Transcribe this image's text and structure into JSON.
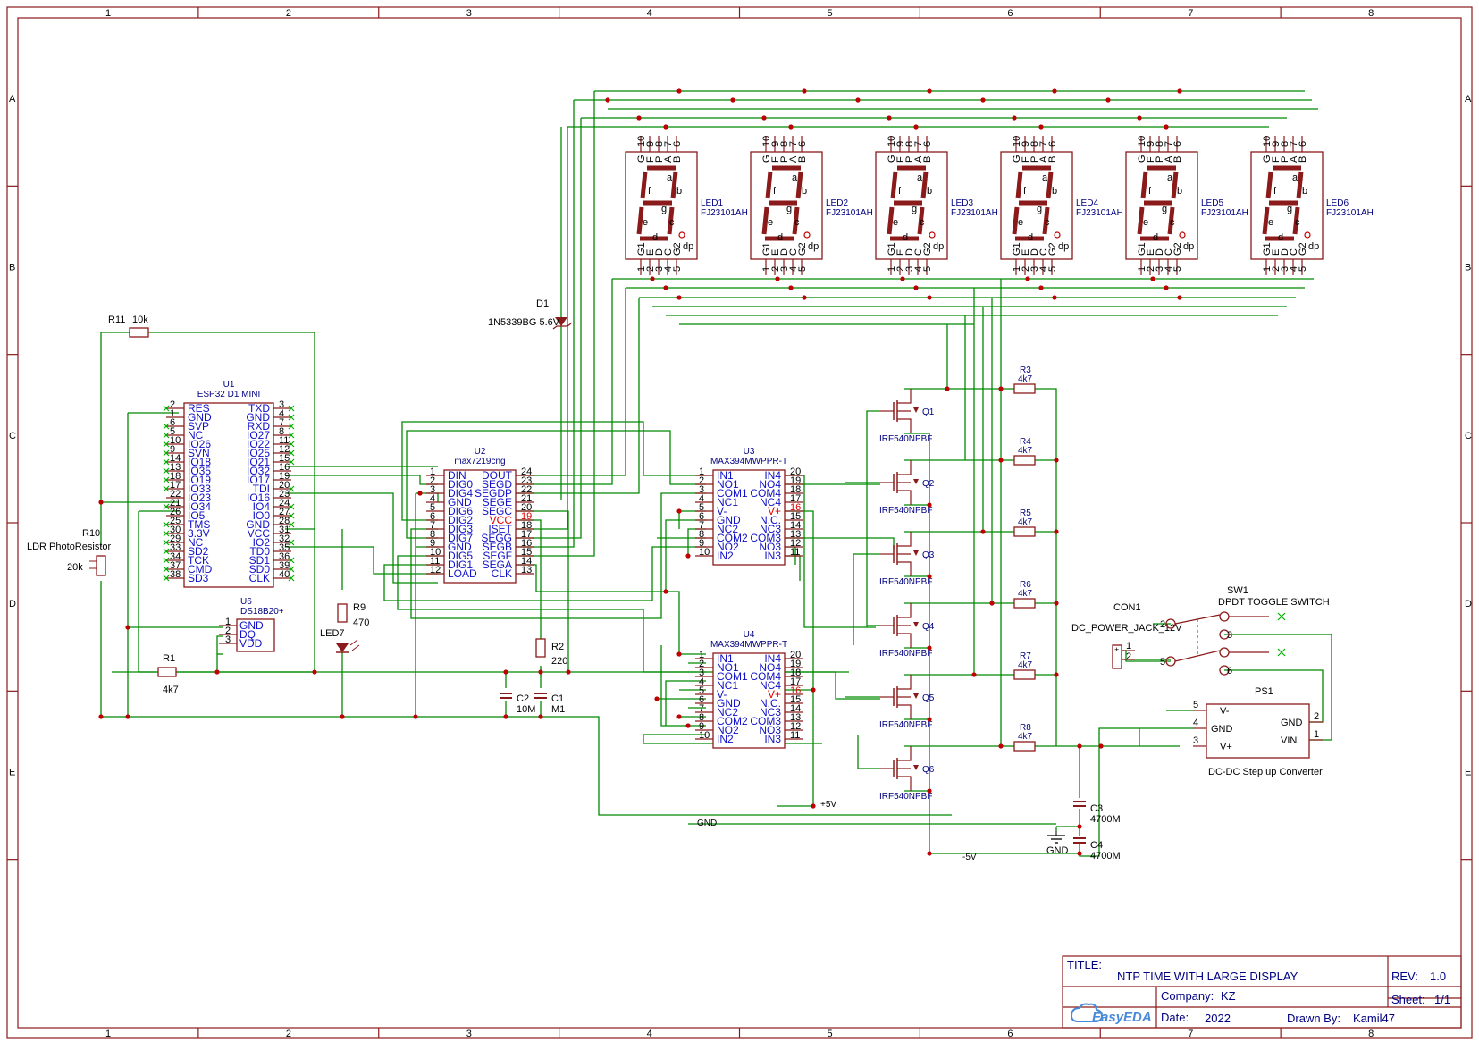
{
  "frame": {
    "col_labels": [
      "1",
      "2",
      "3",
      "4",
      "5",
      "6",
      "7",
      "8"
    ],
    "row_labels": [
      "A",
      "B",
      "C",
      "D",
      "E"
    ]
  },
  "displays": [
    {
      "ref": "LED1",
      "part": "FJ23101AH"
    },
    {
      "ref": "LED2",
      "part": "FJ23101AH"
    },
    {
      "ref": "LED3",
      "part": "FJ23101AH"
    },
    {
      "ref": "LED4",
      "part": "FJ23101AH"
    },
    {
      "ref": "LED5",
      "part": "FJ23101AH"
    },
    {
      "ref": "LED6",
      "part": "FJ23101AH"
    }
  ],
  "display_pins": {
    "top_nums": [
      "10",
      "9",
      "8",
      "7",
      "6"
    ],
    "top_names": [
      "G",
      "F",
      "P",
      "A",
      "B"
    ],
    "bottom_nums": [
      "1",
      "2",
      "3",
      "4",
      "5"
    ],
    "bottom_names": [
      "G1",
      "E",
      "D",
      "C",
      "G2"
    ],
    "seg_labels": [
      "a",
      "b",
      "f",
      "g",
      "e",
      "c",
      "d",
      "dp"
    ]
  },
  "u1": {
    "ref": "U1",
    "name": "ESP32 D1 MINI",
    "left_nums": [
      "2",
      "1",
      "6",
      "5",
      "10",
      "9",
      "14",
      "13",
      "18",
      "17",
      "22",
      "21",
      "26",
      "25",
      "30",
      "29",
      "33",
      "34",
      "37",
      "38"
    ],
    "left_names": [
      "RES",
      "GND",
      "SVP",
      "NC",
      "IO26",
      "SVN",
      "IO18",
      "IO35",
      "IO19",
      "IO33",
      "IO23",
      "IO34",
      "IO5",
      "TMS",
      "3.3V",
      "NC",
      "SD2",
      "TCK",
      "CMD",
      "SD3"
    ],
    "right_names": [
      "TXD",
      "GND",
      "RXD",
      "IO27",
      "IO22",
      "IO25",
      "IO21",
      "IO32",
      "IO17",
      "TDI",
      "IO16",
      "IO4",
      "IO0",
      "GND",
      "VCC",
      "IO2",
      "TD0",
      "SD1",
      "SD0",
      "CLK"
    ],
    "right_nums": [
      "3",
      "4",
      "7",
      "8",
      "11",
      "12",
      "15",
      "16",
      "19",
      "20",
      "23",
      "24",
      "27",
      "28",
      "31",
      "32",
      "35",
      "36",
      "39",
      "40"
    ]
  },
  "u2": {
    "ref": "U2",
    "name": "max7219cng",
    "left_nums": [
      "1",
      "2",
      "3",
      "4",
      "5",
      "6",
      "7",
      "8",
      "9",
      "10",
      "11",
      "12"
    ],
    "left_names": [
      "DIN",
      "DIG0",
      "DIG4",
      "GND",
      "DIG6",
      "DIG2",
      "DIG3",
      "DIG7",
      "GND",
      "DIG5",
      "DIG1",
      "LOAD"
    ],
    "right_names": [
      "DOUT",
      "SEGD",
      "SEGDP",
      "SEGE",
      "SEGC",
      "VCC",
      "ISET",
      "SEGG",
      "SEGB",
      "SEGF",
      "SEGA",
      "CLK"
    ],
    "right_nums": [
      "24",
      "23",
      "22",
      "21",
      "20",
      "19",
      "18",
      "17",
      "16",
      "15",
      "14",
      "13"
    ]
  },
  "u3": {
    "ref": "U3",
    "name": "MAX394MWPPR-T",
    "left_nums": [
      "1",
      "2",
      "3",
      "4",
      "5",
      "6",
      "7",
      "8",
      "9",
      "10"
    ],
    "left_names": [
      "IN1",
      "NO1",
      "COM1",
      "NC1",
      "V-",
      "GND",
      "NC2",
      "COM2",
      "NO2",
      "IN2"
    ],
    "right_names": [
      "IN4",
      "NO4",
      "COM4",
      "NC4",
      "V+",
      "N.C.",
      "NC3",
      "COM3",
      "NO3",
      "IN3"
    ],
    "right_nums": [
      "20",
      "19",
      "18",
      "17",
      "16",
      "15",
      "14",
      "13",
      "12",
      "11"
    ]
  },
  "u4": {
    "ref": "U4",
    "name": "MAX394MWPPR-T",
    "left_nums": [
      "1",
      "2",
      "3",
      "4",
      "5",
      "6",
      "7",
      "8",
      "9",
      "10"
    ],
    "left_names": [
      "IN1",
      "NO1",
      "COM1",
      "NC1",
      "V-",
      "GND",
      "NC2",
      "COM2",
      "NO2",
      "IN2"
    ],
    "right_names": [
      "IN4",
      "NO4",
      "COM4",
      "NC4",
      "V+",
      "N.C.",
      "NC3",
      "COM3",
      "NO3",
      "IN3"
    ],
    "right_nums": [
      "20",
      "19",
      "18",
      "17",
      "16",
      "15",
      "14",
      "13",
      "12",
      "11"
    ]
  },
  "u6": {
    "ref": "U6",
    "name": "DS18B20+",
    "nums": [
      "1",
      "2",
      "3"
    ],
    "names": [
      "GND",
      "DQ",
      "VDD"
    ]
  },
  "mosfets": [
    {
      "ref": "Q1",
      "part": "IRF540NPBF"
    },
    {
      "ref": "Q2",
      "part": "IRF540NPBF"
    },
    {
      "ref": "Q3",
      "part": "IRF540NPBF"
    },
    {
      "ref": "Q4",
      "part": "IRF540NPBF"
    },
    {
      "ref": "Q5",
      "part": "IRF540NPBF"
    },
    {
      "ref": "Q6",
      "part": "IRF540NPBF"
    }
  ],
  "gate_resistors": [
    {
      "ref": "R3",
      "value": "4k7"
    },
    {
      "ref": "R4",
      "value": "4k7"
    },
    {
      "ref": "R5",
      "value": "4k7"
    },
    {
      "ref": "R6",
      "value": "4k7"
    },
    {
      "ref": "R7",
      "value": "4k7"
    },
    {
      "ref": "R8",
      "value": "4k7"
    }
  ],
  "parts": {
    "r11": {
      "ref": "R11",
      "value": "10k"
    },
    "r10": {
      "ref": "R10",
      "desc": "LDR PhotoResistor",
      "value": "20k"
    },
    "r1": {
      "ref": "R1",
      "value": "4k7"
    },
    "r9": {
      "ref": "R9",
      "value": "470"
    },
    "led7": {
      "ref": "LED7"
    },
    "r2": {
      "ref": "R2",
      "value": "220"
    },
    "c2": {
      "ref": "C2",
      "value": "10M"
    },
    "c1": {
      "ref": "C1",
      "value": "M1"
    },
    "d1": {
      "ref": "D1",
      "value": "1N5339BG 5.6V"
    },
    "c3": {
      "ref": "C3",
      "value": "4700M"
    },
    "c4": {
      "ref": "C4",
      "value": "4700M"
    },
    "con1": {
      "ref": "CON1",
      "desc": "DC_POWER_JACK_12V",
      "nums": [
        "1",
        "2"
      ]
    },
    "sw1": {
      "ref": "SW1",
      "desc": "DPDT TOGGLE SWITCH",
      "nums": [
        "2",
        "3",
        "5",
        "6"
      ]
    },
    "ps1": {
      "ref": "PS1",
      "desc": "DC-DC Step up Converter",
      "left_nums": [
        "5",
        "4",
        "3"
      ],
      "left_names": [
        "V-",
        "GND",
        "V+"
      ],
      "right_names": [
        "GND",
        "VIN"
      ],
      "right_nums": [
        "2",
        "1"
      ]
    }
  },
  "net_labels": {
    "p5v": "+5V",
    "m5v": "-5V",
    "gnd": "GND",
    "gnd_symbol": "GND"
  },
  "title_block": {
    "title_label": "TITLE:",
    "title": "NTP TIME WITH LARGE DISPLAY",
    "rev_label": "REV:",
    "rev": "1.0",
    "company_label": "Company:",
    "company": "KZ",
    "sheet_label": "Sheet:",
    "sheet": "1/1",
    "date_label": "Date:",
    "date": "2022",
    "drawn_label": "Drawn By:",
    "drawn": "Kamil47",
    "logo": "EasyEDA"
  },
  "colors": {
    "frame": "#8b1a1a",
    "wire": "#008a00",
    "pinlabel": "#1010c8",
    "power_pin": "#e00000",
    "junction": "#c00000"
  }
}
